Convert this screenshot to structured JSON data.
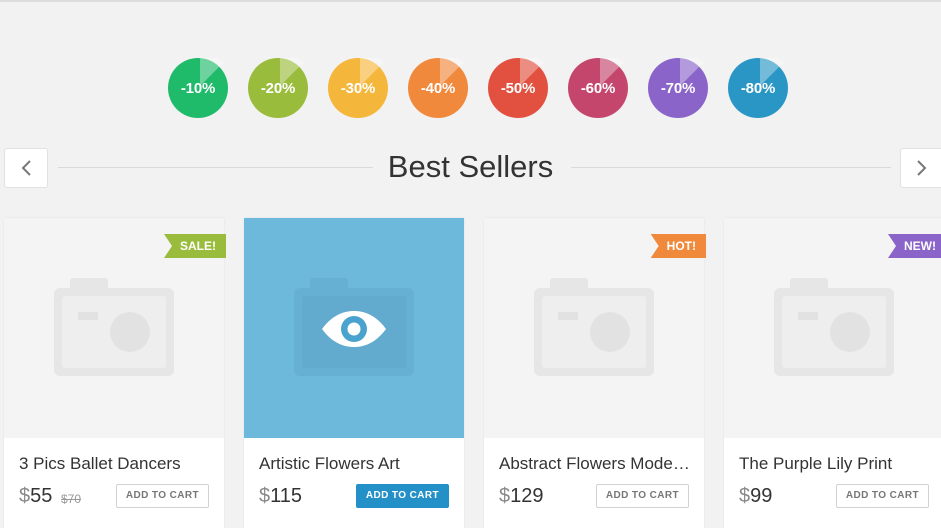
{
  "discounts": [
    {
      "label": "-10%",
      "color": "#1fbb6a"
    },
    {
      "label": "-20%",
      "color": "#9abc3c"
    },
    {
      "label": "-30%",
      "color": "#f5b73b"
    },
    {
      "label": "-40%",
      "color": "#f0893c"
    },
    {
      "label": "-50%",
      "color": "#e2503f"
    },
    {
      "label": "-60%",
      "color": "#c4466d"
    },
    {
      "label": "-70%",
      "color": "#8a64c9"
    },
    {
      "label": "-80%",
      "color": "#2a96c5"
    }
  ],
  "section": {
    "title": "Best Sellers",
    "prev_icon": "chevron-left-icon",
    "next_icon": "chevron-right-icon"
  },
  "products": [
    {
      "name": "3 Pics Ballet Dancers",
      "currency": "$",
      "price": "55",
      "old_price": "$70",
      "badge": "SALE!",
      "badge_color": "#9abc3c",
      "cart_label": "ADD TO CART"
    },
    {
      "name": "Artistic Flowers Art",
      "currency": "$",
      "price": "115",
      "cart_label": "ADD TO CART",
      "hover_icon": "eye-icon",
      "highlight_color": "#6db9dc"
    },
    {
      "name": "Abstract Flowers Moder...",
      "currency": "$",
      "price": "129",
      "badge": "HOT!",
      "badge_color": "#f0893c",
      "cart_label": "ADD TO CART"
    },
    {
      "name": "The Purple Lily Print",
      "currency": "$",
      "price": "99",
      "badge": "NEW!",
      "badge_color": "#8a64c9",
      "cart_label": "ADD TO CART"
    }
  ]
}
